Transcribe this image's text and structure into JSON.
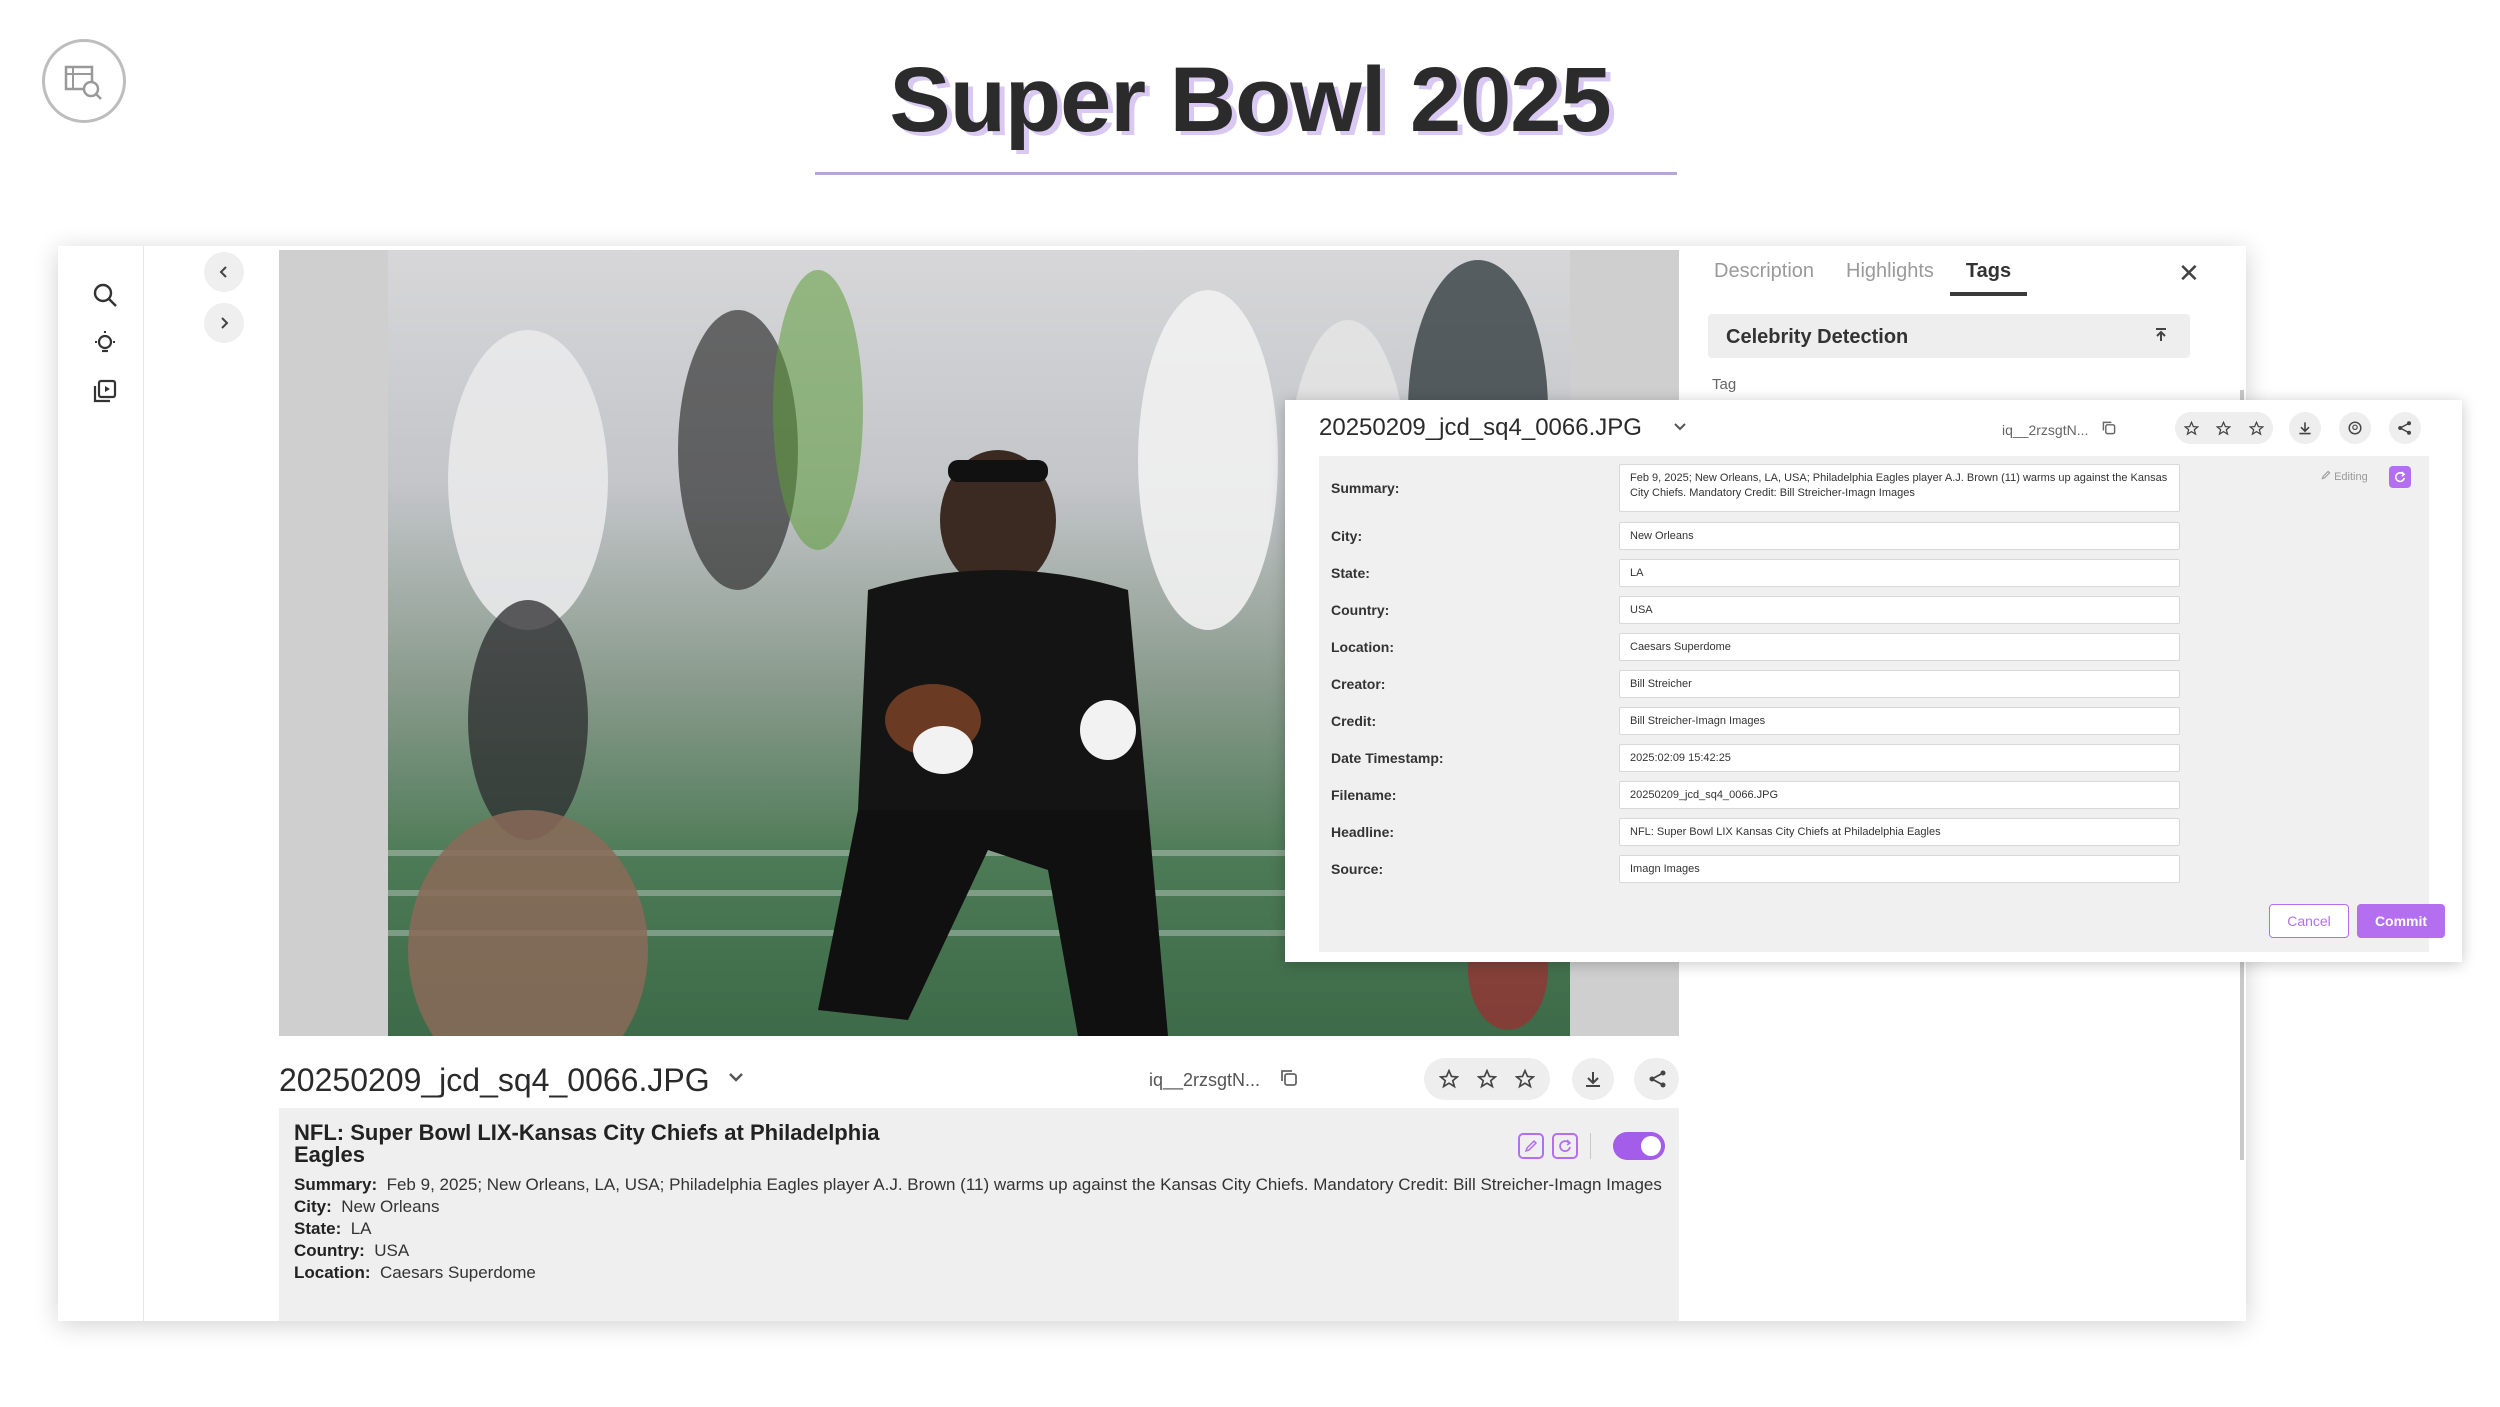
{
  "slide": {
    "title": "Super Bowl 2025"
  },
  "sidebar": {
    "icons": [
      "search-icon",
      "lightbulb-icon",
      "media-library-icon"
    ]
  },
  "viewer": {
    "filename": "20250209_jcd_sq4_0066.JPG",
    "asset_id": "iq__2rzsgtN...",
    "photo_caption": "Philadelphia Eagles player warming up on field"
  },
  "metadata_card": {
    "headline": "NFL: Super Bowl LIX-Kansas City Chiefs at Philadelphia Eagles",
    "rows": [
      {
        "label": "Summary:",
        "value": "Feb 9, 2025; New Orleans, LA, USA; Philadelphia Eagles player A.J. Brown (11) warms up against the Kansas City Chiefs. Mandatory Credit: Bill Streicher-Imagn Images"
      },
      {
        "label": "City:",
        "value": "New Orleans"
      },
      {
        "label": "State:",
        "value": "LA"
      },
      {
        "label": "Country:",
        "value": "USA"
      },
      {
        "label": "Location:",
        "value": "Caesars Superdome"
      }
    ]
  },
  "right_panel": {
    "tabs": [
      "Description",
      "Highlights",
      "Tags"
    ],
    "active_tab": "Tags",
    "accordion_title": "Celebrity Detection",
    "tag_label": "Tag"
  },
  "editor": {
    "filename": "20250209_jcd_sq4_0066.JPG",
    "asset_id": "iq__2rzsgtN...",
    "editing_label": "Editing",
    "fields": [
      {
        "label": "Summary:",
        "value": "Feb 9, 2025; New Orleans, LA, USA; Philadelphia Eagles player A.J. Brown (11) warms up against the Kansas City Chiefs. Mandatory Credit: Bill Streicher-Imagn Images"
      },
      {
        "label": "City:",
        "value": "New Orleans"
      },
      {
        "label": "State:",
        "value": "LA"
      },
      {
        "label": "Country:",
        "value": "USA"
      },
      {
        "label": "Location:",
        "value": "Caesars Superdome"
      },
      {
        "label": "Creator:",
        "value": "Bill Streicher"
      },
      {
        "label": "Credit:",
        "value": "Bill Streicher-Imagn Images"
      },
      {
        "label": "Date Timestamp:",
        "value": "2025:02:09 15:42:25"
      },
      {
        "label": "Filename:",
        "value": "20250209_jcd_sq4_0066.JPG"
      },
      {
        "label": "Headline:",
        "value": "NFL: Super Bowl LIX Kansas City Chiefs at Philadelphia Eagles"
      },
      {
        "label": "Source:",
        "value": "Imagn Images"
      }
    ],
    "cancel_label": "Cancel",
    "commit_label": "Commit"
  },
  "colors": {
    "accent": "#b46ff0",
    "toggle": "#a35de8",
    "title_shadow": "#d8c8f2"
  }
}
